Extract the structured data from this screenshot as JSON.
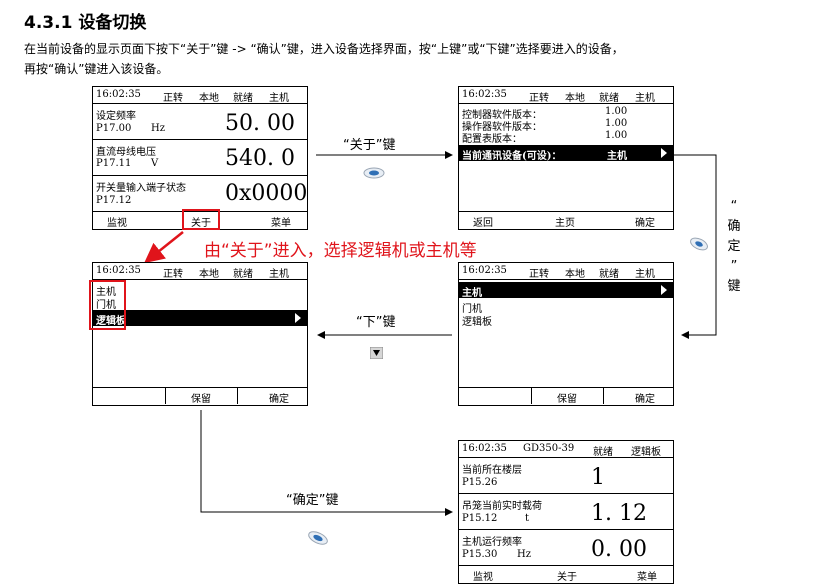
{
  "heading": "4.3.1 设备切换",
  "paragraph": {
    "line1": "在当前设备的显示页面下按下“关于”键 -> “确认”键，进入设备选择界面，按“上键”或“下键”选择要进入的设备，",
    "line2": "再按“确认”键进入该设备。"
  },
  "panel_main": {
    "status": {
      "time": "16:02:35",
      "dir": "正转",
      "mode": "本地",
      "state": "就绪",
      "device": "主机"
    },
    "rows": [
      {
        "name": "设定频率",
        "code": "P17.00",
        "unit": "Hz",
        "value": "50. 00"
      },
      {
        "name": "直流母线电压",
        "code": "P17.11",
        "unit": "V",
        "value": "540. 0"
      },
      {
        "name": "开关量输入端子状态",
        "code": "P17.12",
        "unit": "",
        "value": "0x0000"
      }
    ],
    "footer": {
      "left": "监视",
      "mid": "关于",
      "right": "菜单"
    }
  },
  "panel_about": {
    "status": {
      "time": "16:02:35",
      "dir": "正转",
      "mode": "本地",
      "state": "就绪",
      "device": "主机"
    },
    "info": [
      {
        "label": "控制器软件版本：",
        "value": "1.00"
      },
      {
        "label": "操作器软件版本：",
        "value": "1.00"
      },
      {
        "label": "配置表版本：",
        "value": "1.00"
      }
    ],
    "selected": {
      "label": "当前通讯设备(可设)：",
      "value": "主机"
    },
    "footer": {
      "left": "返回",
      "mid": "主页",
      "right": "确定"
    }
  },
  "panel_select_right": {
    "status": {
      "time": "16:02:35",
      "dir": "正转",
      "mode": "本地",
      "state": "就绪",
      "device": "主机"
    },
    "selected": "主机",
    "items": [
      "门机",
      "逻辑板"
    ],
    "footer": {
      "mid": "保留",
      "right": "确定"
    }
  },
  "panel_select_left": {
    "status": {
      "time": "16:02:35",
      "dir": "正转",
      "mode": "本地",
      "state": "就绪",
      "device": "主机"
    },
    "items": [
      "主机",
      "门机"
    ],
    "selected": "逻辑板",
    "footer": {
      "mid": "保留",
      "right": "确定"
    }
  },
  "panel_result": {
    "status": {
      "time": "16:02:35",
      "model": "GD350-39",
      "state": "就绪",
      "device": "逻辑板"
    },
    "rows": [
      {
        "name": "当前所在楼层",
        "code": "P15.26",
        "unit": "",
        "value": "1"
      },
      {
        "name": "吊笼当前实时载荷",
        "code": "P15.12",
        "unit": "t",
        "value": "1. 12"
      },
      {
        "name": "主机运行频率",
        "code": "P15.30",
        "unit": "Hz",
        "value": "0. 00"
      }
    ],
    "footer": {
      "left": "监视",
      "mid": "关于",
      "right": "菜单"
    }
  },
  "captions": {
    "about_key": "“关于”键",
    "down_key": "“下”键",
    "confirm_key": "“确定”键",
    "confirm_vertical": [
      "“",
      "确",
      "定",
      "”",
      "键"
    ],
    "red_note": "由“关于”进入，选择逻辑机或主机等"
  },
  "icons": {
    "key": "oval-key-icon",
    "down": "down-triangle-key-icon"
  },
  "colors": {
    "accent_red": "#e0141b",
    "lcd_inverse": "#000000"
  }
}
